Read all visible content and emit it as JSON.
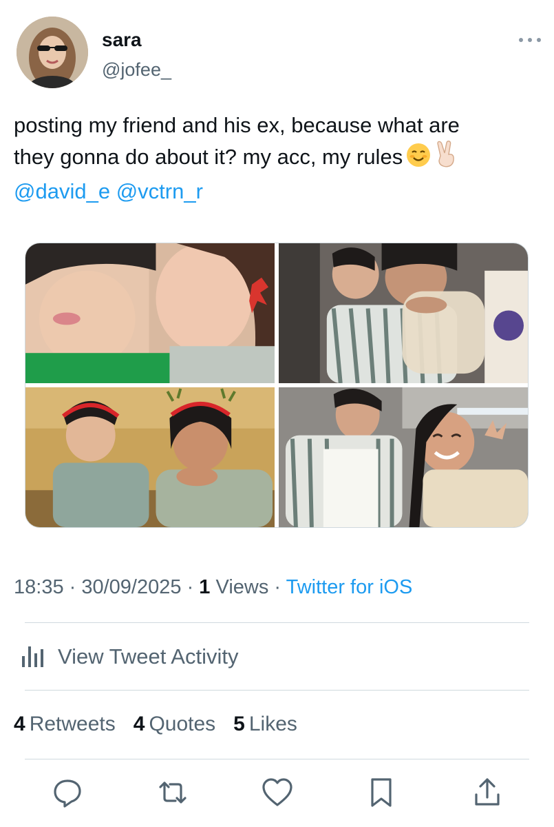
{
  "author": {
    "display_name": "sara",
    "handle": "@jofee_"
  },
  "tweet": {
    "line1": "posting my friend and his ex, because what are",
    "line2": "they gonna do about it? my acc, my rules",
    "mention1": "@david_e",
    "mention2": "@vctrn_r",
    "emojis": [
      "smiling-face-icon",
      "victory-hand-icon"
    ]
  },
  "media_count": 4,
  "meta": {
    "time": "18:35",
    "separator": " · ",
    "date": "30/09/2025",
    "views_count": "1",
    "views_label": "Views",
    "source": "Twitter for iOS"
  },
  "activity": {
    "label": "View Tweet Activity"
  },
  "stats": {
    "retweets_count": "4",
    "retweets_label": "Retweets",
    "quotes_count": "4",
    "quotes_label": "Quotes",
    "likes_count": "5",
    "likes_label": "Likes"
  },
  "colors": {
    "accent": "#1d9bf0",
    "text_primary": "#0f1419",
    "text_secondary": "#536471",
    "border": "#cfd9de"
  }
}
